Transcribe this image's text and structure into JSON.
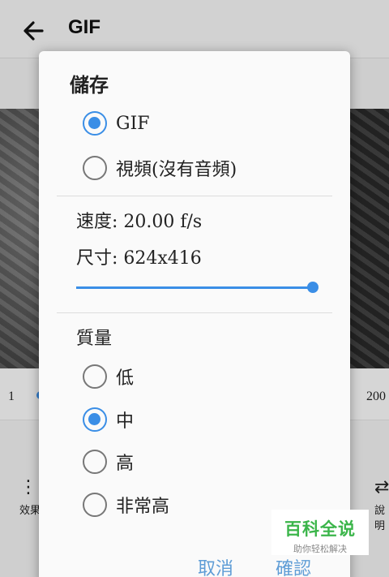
{
  "app": {
    "title": "GIF",
    "range_min": "1",
    "range_max": "200",
    "tools": {
      "left_label": "效果",
      "right_label": "說明"
    }
  },
  "dialog": {
    "title": "儲存",
    "format_options": [
      {
        "label": "GIF",
        "selected": true
      },
      {
        "label": "視頻(沒有音頻)",
        "selected": false
      }
    ],
    "speed_text": "速度: 20.00 f/s",
    "size_text": "尺寸: 624x416",
    "size_slider": {
      "value_fraction": 1.0
    },
    "quality_title": "質量",
    "quality_options": [
      {
        "label": "低",
        "selected": false
      },
      {
        "label": "中",
        "selected": true
      },
      {
        "label": "高",
        "selected": false
      },
      {
        "label": "非常高",
        "selected": false
      }
    ],
    "cancel_label": "取消",
    "confirm_label": "確認"
  },
  "watermark": {
    "main": "百科全说",
    "sub": "助你轻松解决"
  },
  "colors": {
    "accent": "#3a8ee6",
    "button_text": "#5f9dd6",
    "watermark_green": "#3bb54a"
  },
  "icons": {
    "back": "arrow-left-icon",
    "left_tool": "grid-dots-icon",
    "right_tool": "swap-arrows-icon"
  }
}
